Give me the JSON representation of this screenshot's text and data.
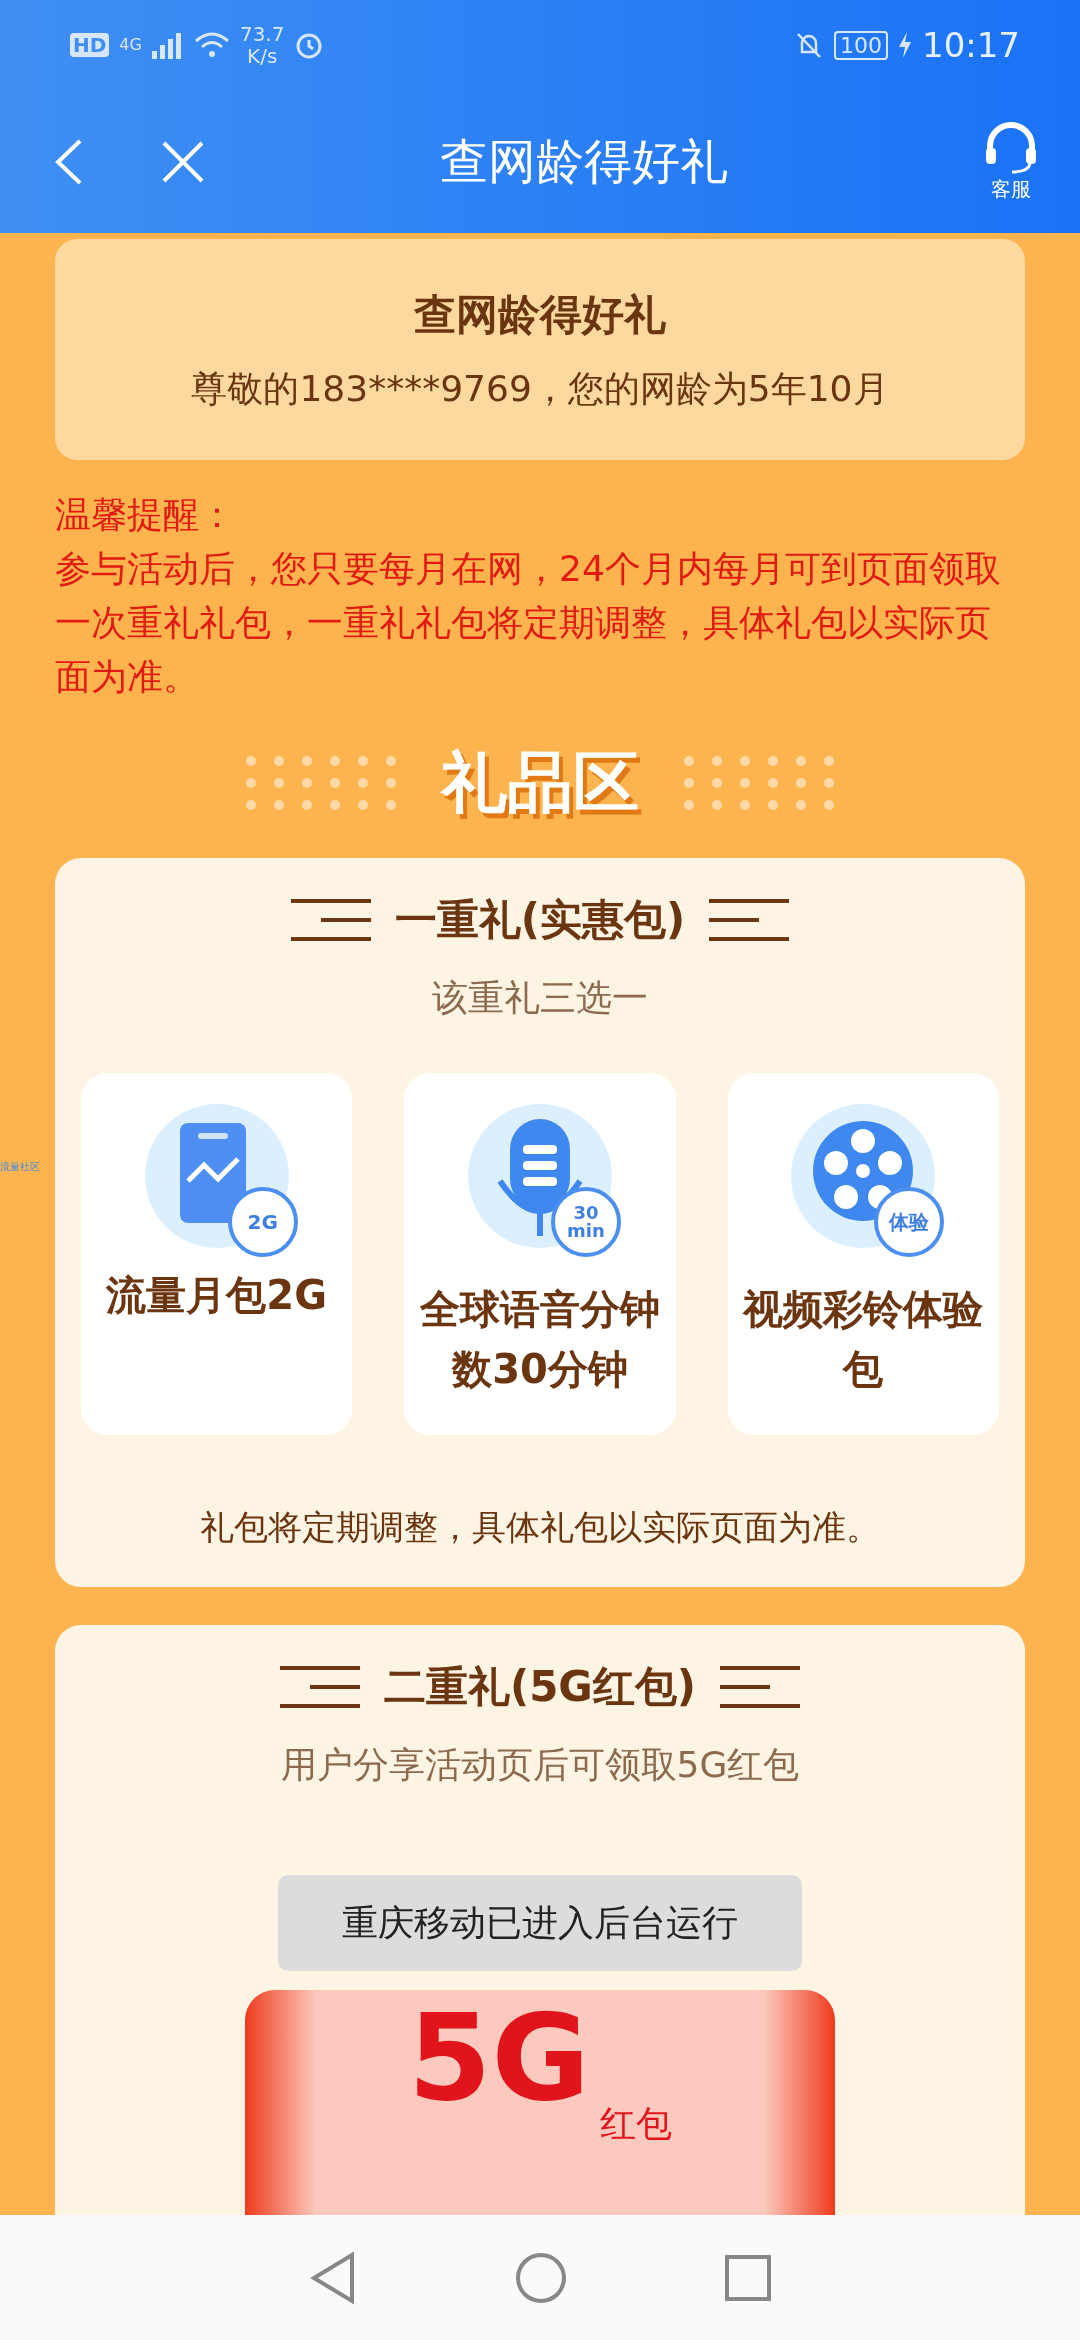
{
  "status_bar": {
    "hd": "HD",
    "network": "4G",
    "speed": "73.7",
    "speed_unit": "K/s",
    "battery": "100",
    "time": "10:17"
  },
  "nav": {
    "title": "查网龄得好礼",
    "service_label": "客服"
  },
  "side_tag": "流量社区",
  "info_card": {
    "title": "查网龄得好礼",
    "text": "尊敬的183****9769，您的网龄为5年10月"
  },
  "reminder": {
    "title": "温馨提醒：",
    "text": "参与活动后，您只要每月在网，24个月内每月可到页面领取一次重礼礼包，一重礼礼包将定期调整，具体礼包以实际页面为准。"
  },
  "section_title": "礼品区",
  "gift_sections": [
    {
      "title": "一重礼(实惠包)",
      "subtitle": "该重礼三选一",
      "items": [
        {
          "kind": "data",
          "label": "流量月包2G",
          "badge": [
            "2G"
          ]
        },
        {
          "kind": "voice",
          "label": "全球语音分钟数30分钟",
          "badge": [
            "30",
            "min"
          ]
        },
        {
          "kind": "video",
          "label": "视频彩铃体验包",
          "badge": [
            "体验"
          ]
        }
      ],
      "note": "礼包将定期调整，具体礼包以实际页面为准。"
    },
    {
      "title": "二重礼(5G红包)",
      "subtitle": "用户分享活动页后可领取5G红包",
      "banner": {
        "big": "5G",
        "small": "红包"
      }
    }
  ],
  "toast": "重庆移动已进入后台运行"
}
